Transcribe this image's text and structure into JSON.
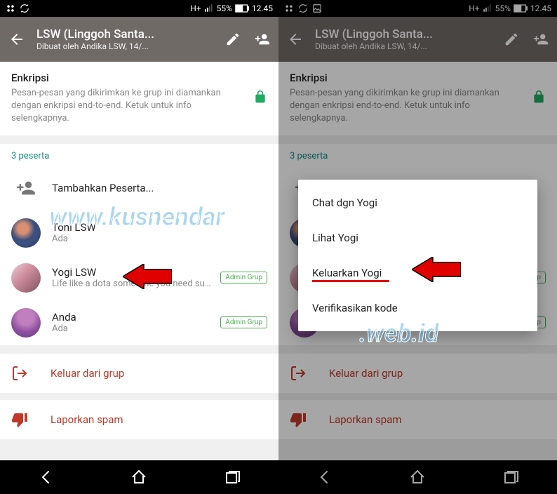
{
  "statusbar": {
    "network": "H+",
    "signal": "55%",
    "time": "12.45"
  },
  "header": {
    "title": "LSW (Linggoh Santa...",
    "subtitle": "Dibuat oleh Andika LSW, 14/..."
  },
  "encryption": {
    "title": "Enkripsi",
    "body": "Pesan-pesan yang dikirimkan ke grup ini diamankan dengan enkripsi end-to-end. Ketuk untuk info selengkapnya."
  },
  "peserta_label": "3 peserta",
  "add_label": "Tambahkan Peserta...",
  "members": [
    {
      "name": "Toni LSW",
      "status": "Ada",
      "admin": false
    },
    {
      "name": "Yogi LSW",
      "status": "Life like a dota sometime you need support some…",
      "admin": true
    },
    {
      "name": "Anda",
      "status": "Ada",
      "admin": true
    }
  ],
  "admin_badge": "Admin Grup",
  "actions": {
    "leave": "Keluar dari grup",
    "spam": "Laporkan spam"
  },
  "popup": {
    "items": [
      "Chat dgn Yogi",
      "Lihat Yogi",
      "Keluarkan Yogi",
      "Verifikasikan kode"
    ],
    "highlight_index": 2
  },
  "watermark": {
    "line1": "www.kusnendar",
    "line2": ".web.id"
  }
}
